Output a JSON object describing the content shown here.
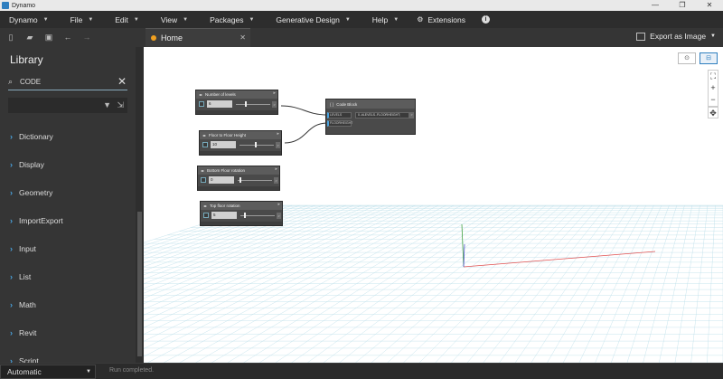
{
  "window": {
    "title": "Dynamo",
    "controls": [
      "—",
      "❐",
      "✕"
    ]
  },
  "menu": {
    "items": [
      {
        "label": "Dynamo"
      },
      {
        "label": "File"
      },
      {
        "label": "Edit"
      },
      {
        "label": "View"
      },
      {
        "label": "Packages"
      },
      {
        "label": "Generative Design"
      },
      {
        "label": "Help"
      }
    ],
    "extensions_label": "Extensions"
  },
  "toolbar": {
    "tab_label": "Home",
    "export_label": "Export as Image"
  },
  "library": {
    "title": "Library",
    "search_value": "CODE",
    "categories": [
      "Dictionary",
      "Display",
      "Geometry",
      "ImportExport",
      "Input",
      "List",
      "Math",
      "Revit",
      "Script"
    ]
  },
  "nodes": {
    "levels": {
      "title": "Number of levels",
      "value": "6",
      "slider_fraction": 0.25
    },
    "floor_height": {
      "title": "Floor to Floor Height",
      "value": "10",
      "slider_fraction": 0.45
    },
    "bottom_rotation": {
      "title": "Bottom Floor rotation",
      "value": "0",
      "slider_fraction": 0.05
    },
    "top_rotation": {
      "title": "Top floor rotation",
      "value": "5",
      "slider_fraction": 0.1
    },
    "code_block": {
      "title": "Code Block",
      "port1": "LEVELS",
      "port2": "FLOORHEIGHT",
      "code": "0..#LEVELS..FLOORHEIGHT;",
      "output": ">"
    }
  },
  "statusbar": {
    "run_mode": "Automatic",
    "status": "Run completed."
  },
  "colors": {
    "accent": "#4aa3df",
    "axis_x": "#e05050",
    "axis_y": "#40a040",
    "axis_z": "#5050d0",
    "grid": "#b9dde8"
  }
}
